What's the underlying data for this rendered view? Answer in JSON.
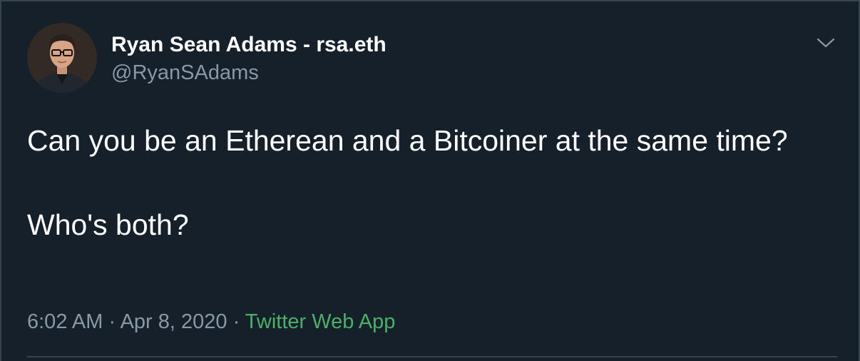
{
  "author": {
    "display_name": "Ryan Sean Adams - rsa.eth",
    "handle": "@RyanSAdams"
  },
  "tweet": {
    "line1": "Can you be an Etherean and a Bitcoiner at the same time?",
    "line2": "Who's both?"
  },
  "meta": {
    "time": "6:02 AM",
    "sep1": " · ",
    "date": "Apr 8, 2020",
    "sep2": " · ",
    "source": "Twitter Web App"
  },
  "colors": {
    "background": "#16202b",
    "text": "#ffffff",
    "secondary": "#8899a6",
    "source_link": "#4caf68",
    "divider": "#38444d"
  },
  "icons": {
    "menu": "chevron-down-icon"
  }
}
